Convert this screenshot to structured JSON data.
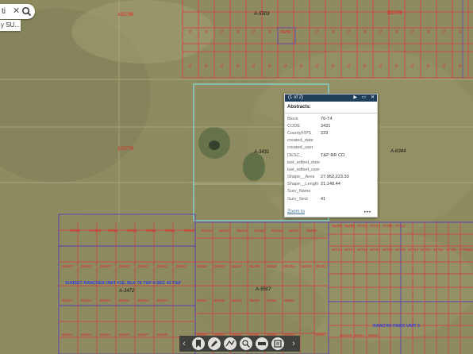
{
  "search": {
    "value": "ti",
    "clear_icon": "close-icon",
    "search_icon": "search-icon"
  },
  "suggestion": "y SU...",
  "map": {
    "colors": {
      "parcel_line": "#d83a3a",
      "subdivision_line": "#5a3fb5",
      "selection": "#7fe0e0",
      "label_red": "#e02424",
      "label_blue": "#2e3fe0"
    },
    "block_labels": [
      "A-5503",
      "A-3431",
      "A-6344",
      "A-5507",
      "A-3472"
    ],
    "parcel_ids": [
      "103786",
      "103778",
      "0",
      "56296"
    ],
    "subdivision_labels": [
      "SUNSET RANCHES UNIT #1E, BLK 76 T&P #-SEC 43 T&P",
      "RANCHO PABO UNIT 3"
    ],
    "grid_ids": [
      "60435",
      "103326",
      "60424",
      "60423",
      "60422",
      "60421",
      "60425",
      "56211",
      "56233",
      "56234",
      "56235",
      "56236",
      "56237",
      "56238",
      "56239",
      "60426",
      "60429",
      "60430",
      "60431",
      "60432",
      "60433",
      "60434",
      "60436",
      "56237",
      "56248",
      "56243",
      "56244",
      "56242",
      "56241",
      "56243",
      "56240",
      "60443",
      "60441",
      "60440",
      "60439",
      "60437",
      "60438",
      "56246",
      "56245",
      "56251",
      "56252",
      "56253",
      "56254",
      "60444",
      "60445",
      "60447",
      "60448",
      "60449",
      "60450",
      "56262",
      "56261",
      "56255",
      "56258",
      "56257",
      "56256",
      "56255",
      "57716",
      "57714",
      "57715",
      "57712",
      "57713",
      "57717",
      "57738",
      "57737",
      "57736",
      "57735",
      "57734",
      "57733",
      "57754",
      "57755",
      "57756"
    ]
  },
  "popup": {
    "header": "(1 of 2)",
    "title": "Abstracts:",
    "fields": [
      {
        "k": "Block",
        "v": "76-T4"
      },
      {
        "k": "CODE",
        "v": "3431"
      },
      {
        "k": "CountyFIPS",
        "v": "229"
      },
      {
        "k": "created_date",
        "v": ""
      },
      {
        "k": "created_user",
        "v": ""
      },
      {
        "k": "DESC_",
        "v": "T&P RR CO"
      },
      {
        "k": "last_edited_date",
        "v": ""
      },
      {
        "k": "last_edited_user",
        "v": ""
      },
      {
        "k": "Shape__Area",
        "v": "27,952,223.33"
      },
      {
        "k": "Shape__Length",
        "v": "21,148.44"
      },
      {
        "k": "Surv_Name",
        "v": ""
      },
      {
        "k": "Surv_Sect",
        "v": "41"
      }
    ],
    "zoom_link": "Zoom to",
    "more": "•••",
    "play_glyph": "▶",
    "dock_glyph": "▭",
    "close_glyph": "✕"
  },
  "toolbar": {
    "prev_glyph": "‹",
    "next_glyph": "›",
    "buttons": [
      "bookmark-icon",
      "draw-icon",
      "measure-icon",
      "query-icon",
      "legend-icon",
      "layers-icon"
    ]
  }
}
